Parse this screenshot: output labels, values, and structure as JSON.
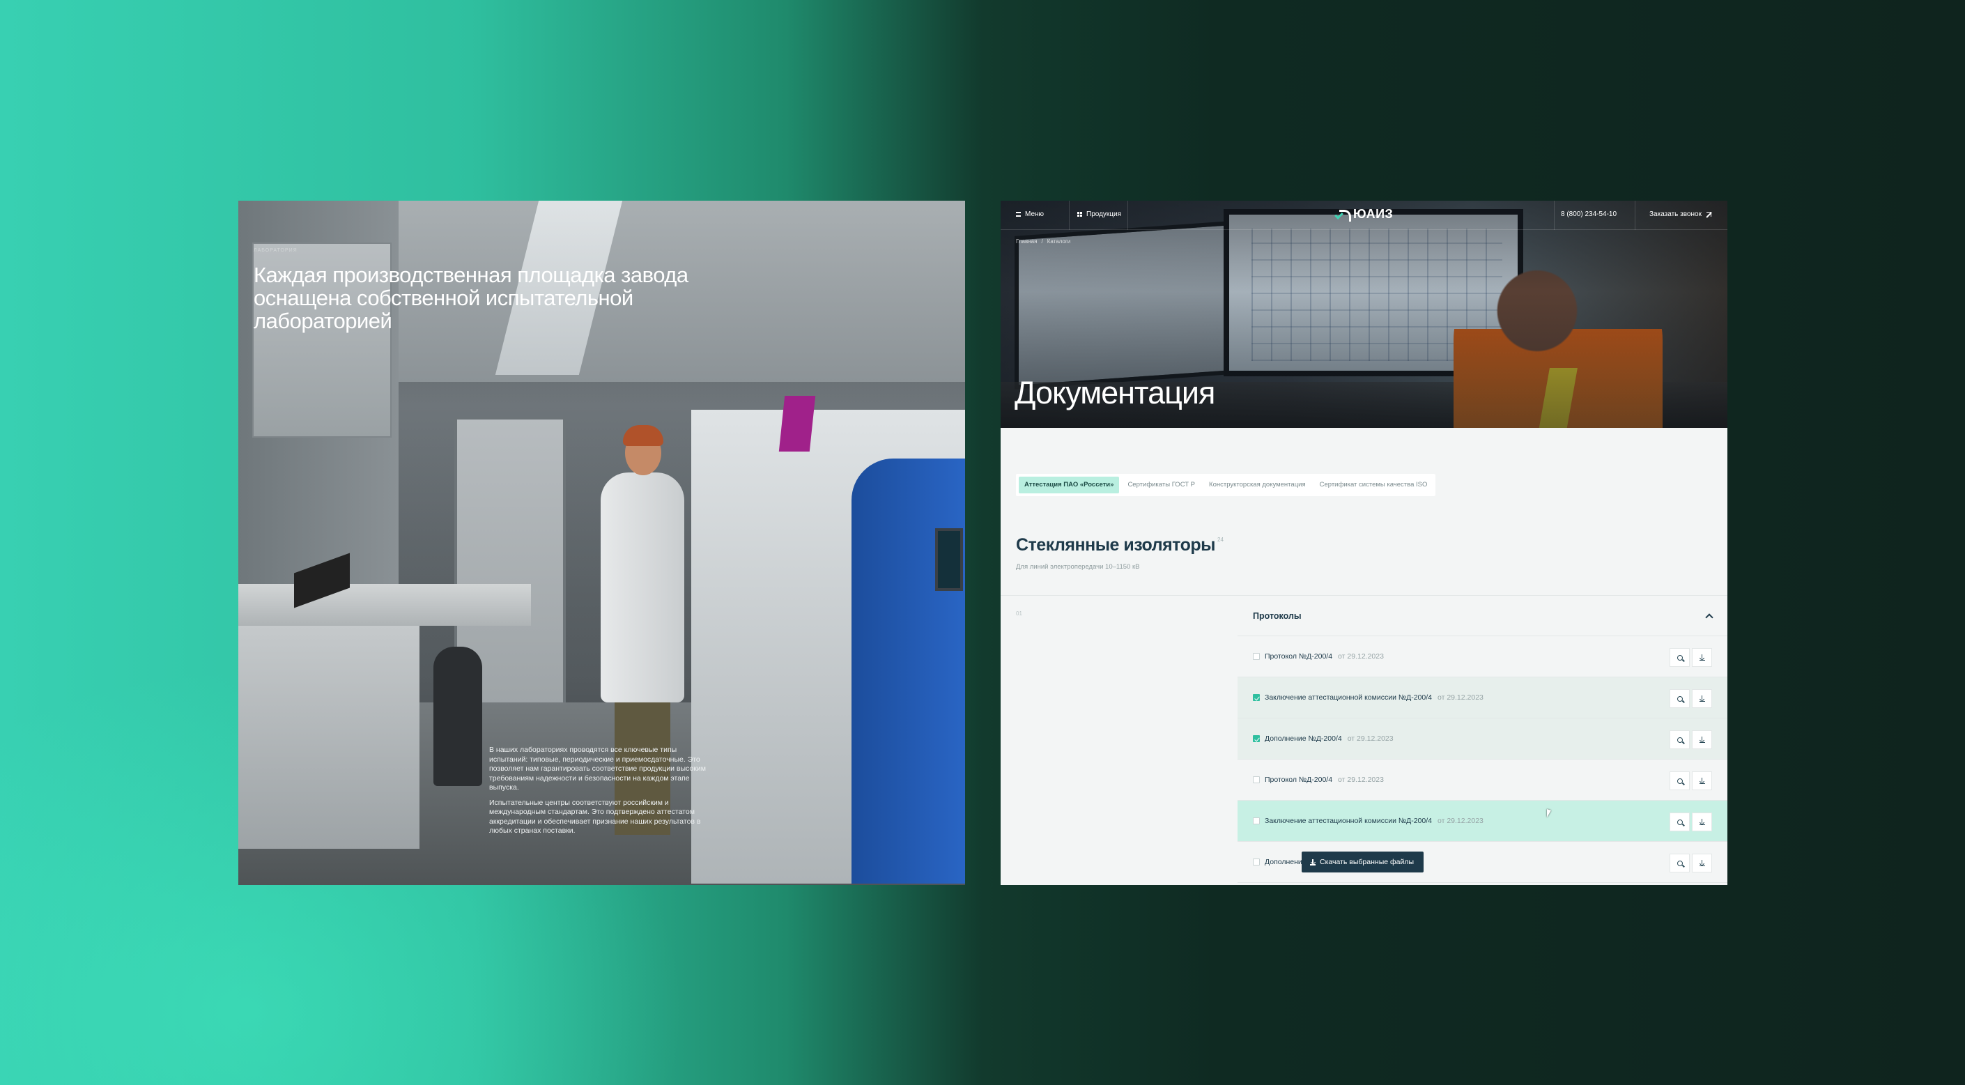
{
  "left_panel": {
    "kicker": "ЛАБОРАТОРИЯ",
    "title": "Каждая производственная площадка завода оснащена собственной испытательной лабораторией",
    "paragraphs": [
      "В наших лабораториях проводятся все ключевые типы испытаний: типовые, периодические и приемосдаточные. Это позволяет нам гарантировать соответствие продукции высоким требованиям надежности и безопасности на каждом этапе выпуска.",
      "Испытательные центры соответствуют российским и международным стандартам. Это подтверждено аттестатом аккредитации и обеспечивает признание наших результатов в любых странах поставки."
    ]
  },
  "right_panel": {
    "nav": {
      "menu_label": "Меню",
      "products_label": "Продукция",
      "logo_text": "ЮАИЗ",
      "phone": "8 (800) 234-54-10",
      "callback_label": "Заказать звонок"
    },
    "breadcrumb": {
      "home": "Главная",
      "separator": "/",
      "current": "Каталоги"
    },
    "hero_title": "Документация",
    "tabs": [
      {
        "label": "Аттестация ПАО «Россети»",
        "active": true
      },
      {
        "label": "Сертификаты ГОСТ Р",
        "active": false
      },
      {
        "label": "Конструкторская документация",
        "active": false
      },
      {
        "label": "Сертификат системы качества ISO",
        "active": false
      }
    ],
    "section": {
      "title": "Стеклянные изоляторы",
      "count": "24",
      "subtitle": "Для линий электропередачи 10–1150 кВ",
      "index": "01"
    },
    "group": {
      "title": "Протоколы",
      "rows": [
        {
          "name": "Протокол №Д-200/4",
          "date": "от 29.12.2023",
          "checked": false,
          "state": "normal"
        },
        {
          "name": "Заключение аттестационной комиссии №Д-200/4",
          "date": "от 29.12.2023",
          "checked": true,
          "state": "checked"
        },
        {
          "name": "Дополнение №Д-200/4",
          "date": "от 29.12.2023",
          "checked": true,
          "state": "checked"
        },
        {
          "name": "Протокол №Д-200/4",
          "date": "от 29.12.2023",
          "checked": false,
          "state": "normal"
        },
        {
          "name": "Заключение аттестационной комиссии №Д-200/4",
          "date": "от 29.12.2023",
          "checked": false,
          "state": "hover"
        },
        {
          "name": "Дополнение",
          "date": "",
          "checked": false,
          "state": "normal"
        }
      ]
    },
    "download_button": "Скачать выбранные файлы"
  },
  "colors": {
    "accent": "#2fbf9f",
    "accent_light": "#b9efe0",
    "dark_blue": "#1e3a4a"
  }
}
